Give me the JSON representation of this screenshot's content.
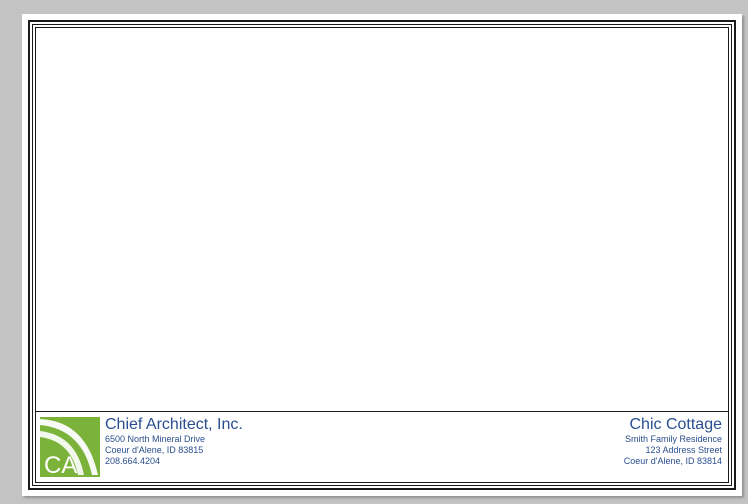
{
  "company": {
    "name": "Chief Architect, Inc.",
    "address_line1": "6500 North Mineral Drive",
    "address_line2": "Coeur d'Alene, ID  83815",
    "phone": "208.664.4204",
    "logo_text": "CA"
  },
  "project": {
    "name": "Chic Cottage",
    "client": "Smith Family Residence",
    "address_line1": "123 Address Street",
    "address_line2": "Coeur d'Alene, ID  83814"
  },
  "colors": {
    "text_blue": "#2a4f8f",
    "logo_green": "#7bb33a",
    "background": "#c3c3c3"
  }
}
